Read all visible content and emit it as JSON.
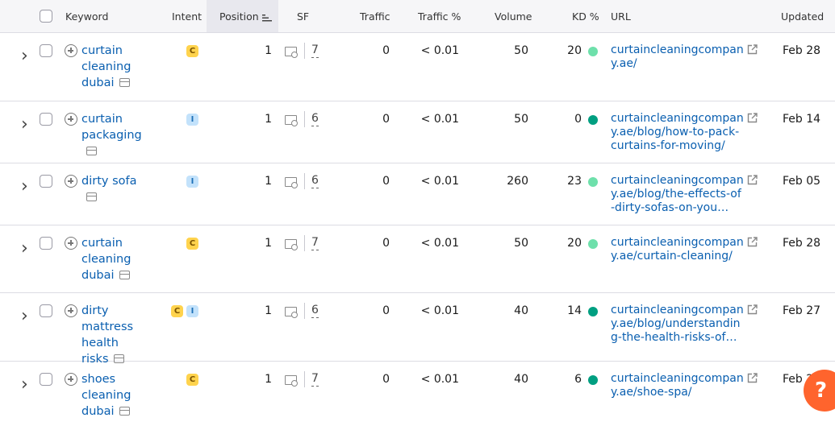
{
  "header": {
    "keyword": "Keyword",
    "intent": "Intent",
    "position": "Position",
    "sf": "SF",
    "traffic": "Traffic",
    "traffic_pct": "Traffic %",
    "volume": "Volume",
    "kd_pct": "KD %",
    "url": "URL",
    "updated": "Updated"
  },
  "colors": {
    "link": "#0a5fb0",
    "kd_light": "#6ee0ab",
    "kd_dark": "#009f81",
    "help": "#ff642d"
  },
  "rows": [
    {
      "kw": [
        "curtain",
        "cleaning",
        "dubai"
      ],
      "intent": [
        "C"
      ],
      "position": "1",
      "sf": "7",
      "traffic": "0",
      "traffic_pct": "< 0.01",
      "volume": "50",
      "kd": "20",
      "kd_level": "light",
      "url": "curtaincleaningcompany.ae/",
      "updated": "Feb 28"
    },
    {
      "kw": [
        "curtain",
        "packaging"
      ],
      "intent": [
        "I"
      ],
      "position": "1",
      "sf": "6",
      "traffic": "0",
      "traffic_pct": "< 0.01",
      "volume": "50",
      "kd": "0",
      "kd_level": "dark",
      "url": "curtaincleaningcompany.ae/blog/how-to-pack-curtains-for-moving/",
      "updated": "Feb 14"
    },
    {
      "kw": [
        "dirty sofa"
      ],
      "intent": [
        "I"
      ],
      "position": "1",
      "sf": "6",
      "traffic": "0",
      "traffic_pct": "< 0.01",
      "volume": "260",
      "kd": "23",
      "kd_level": "light",
      "url": "curtaincleaningcompany.ae/blog/the-effects-of-dirty-sofas-on-you…",
      "updated": "Feb 05"
    },
    {
      "kw": [
        "curtain",
        "cleaning",
        "dubai"
      ],
      "intent": [
        "C"
      ],
      "position": "1",
      "sf": "7",
      "traffic": "0",
      "traffic_pct": "< 0.01",
      "volume": "50",
      "kd": "20",
      "kd_level": "light",
      "url": "curtaincleaningcompany.ae/curtain-cleaning/",
      "updated": "Feb 28"
    },
    {
      "kw": [
        "dirty",
        "mattress",
        "health risks"
      ],
      "intent": [
        "C",
        "I"
      ],
      "position": "1",
      "sf": "6",
      "traffic": "0",
      "traffic_pct": "< 0.01",
      "volume": "40",
      "kd": "14",
      "kd_level": "dark",
      "url": "curtaincleaningcompany.ae/blog/understanding-the-health-risks-of…",
      "updated": "Feb 27"
    },
    {
      "kw": [
        "shoes",
        "cleaning",
        "dubai"
      ],
      "intent": [
        "C"
      ],
      "position": "1",
      "sf": "7",
      "traffic": "0",
      "traffic_pct": "< 0.01",
      "volume": "40",
      "kd": "6",
      "kd_level": "dark",
      "url": "curtaincleaningcompany.ae/shoe-spa/",
      "updated": "Feb 2"
    }
  ],
  "help": {
    "icon": "?"
  }
}
